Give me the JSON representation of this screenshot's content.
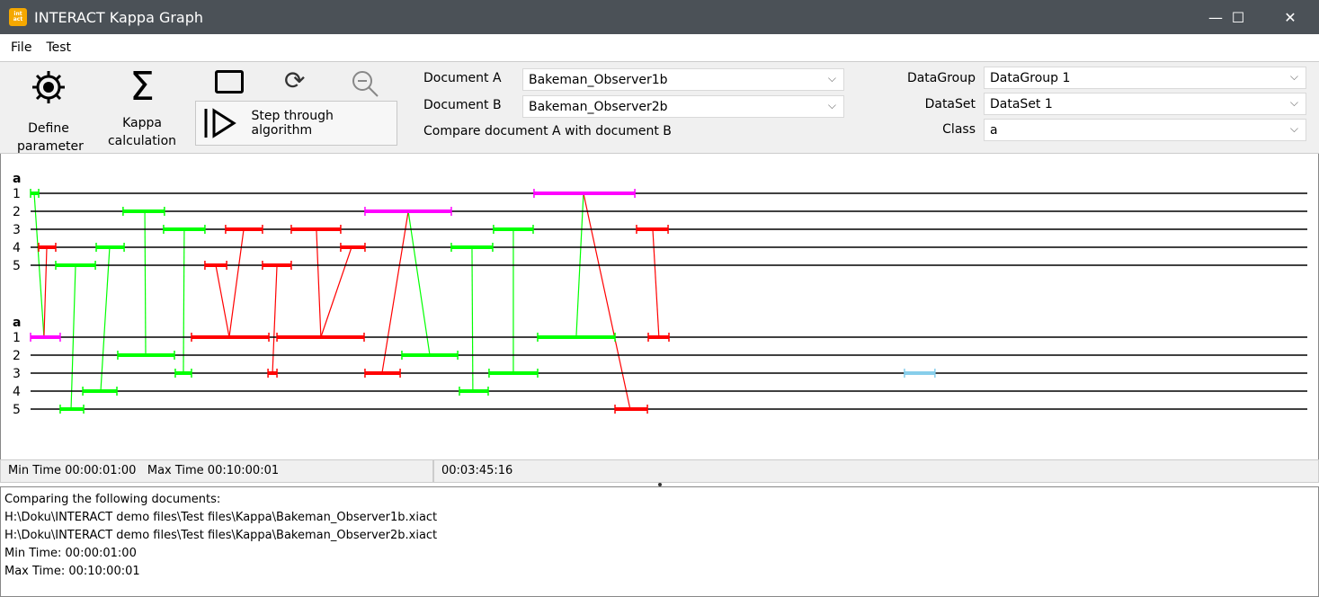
{
  "window": {
    "title": "INTERACT Kappa Graph",
    "logo_text": "interact",
    "minimize": "—",
    "maximize": "☐",
    "close": "✕"
  },
  "menu": [
    "File",
    "Test"
  ],
  "toolbar": {
    "define_parameter": "Define parameter",
    "kappa_calculation": "Kappa calculation",
    "step_through": "Step through algorithm",
    "document_a_label": "Document A",
    "document_a_value": "Bakeman_Observer1b",
    "document_b_label": "Document B",
    "document_b_value": "Bakeman_Observer2b",
    "compare_text": "Compare document A with document B",
    "datagroup_label": "DataGroup",
    "datagroup_value": "DataGroup 1",
    "dataset_label": "DataSet",
    "dataset_value": "DataSet 1",
    "class_label": "Class",
    "class_value": "a"
  },
  "graph": {
    "time_range_seconds": [
      1,
      600
    ],
    "colors": {
      "green": "#00ff00",
      "red": "#ff0000",
      "magenta": "#ff00ff",
      "lightblue": "#87ceeb"
    },
    "doc_a": {
      "class": "a",
      "rows": [
        "1",
        "2",
        "3",
        "4",
        "5"
      ],
      "segments": [
        {
          "row": 1,
          "start": 1.0,
          "end": 4.8,
          "color": "green"
        },
        {
          "row": 1,
          "start": 237.2,
          "end": 284.5,
          "color": "magenta"
        },
        {
          "row": 2,
          "start": 44.4,
          "end": 63.8,
          "color": "green"
        },
        {
          "row": 2,
          "start": 157.9,
          "end": 198.4,
          "color": "magenta"
        },
        {
          "row": 3,
          "start": 63.4,
          "end": 82.8,
          "color": "green"
        },
        {
          "row": 3,
          "start": 92.5,
          "end": 109.8,
          "color": "red"
        },
        {
          "row": 3,
          "start": 123.3,
          "end": 146.5,
          "color": "red"
        },
        {
          "row": 3,
          "start": 218.2,
          "end": 236.8,
          "color": "green"
        },
        {
          "row": 3,
          "start": 285.3,
          "end": 300.1,
          "color": "red"
        },
        {
          "row": 4,
          "start": 4.8,
          "end": 12.8,
          "color": "red"
        },
        {
          "row": 4,
          "start": 31.8,
          "end": 44.9,
          "color": "green"
        },
        {
          "row": 4,
          "start": 146.5,
          "end": 157.9,
          "color": "red"
        },
        {
          "row": 4,
          "start": 198.4,
          "end": 217.8,
          "color": "green"
        },
        {
          "row": 5,
          "start": 12.8,
          "end": 31.4,
          "color": "green"
        },
        {
          "row": 5,
          "start": 82.8,
          "end": 93.0,
          "color": "red"
        },
        {
          "row": 5,
          "start": 109.8,
          "end": 123.3,
          "color": "red"
        }
      ]
    },
    "doc_b": {
      "class": "a",
      "rows": [
        "1",
        "2",
        "3",
        "4",
        "5"
      ],
      "segments": [
        {
          "row": 1,
          "start": 1.0,
          "end": 14.9,
          "color": "magenta"
        },
        {
          "row": 1,
          "start": 76.5,
          "end": 112.8,
          "color": "red"
        },
        {
          "row": 1,
          "start": 116.6,
          "end": 157.5,
          "color": "red"
        },
        {
          "row": 1,
          "start": 238.9,
          "end": 275.2,
          "color": "green"
        },
        {
          "row": 1,
          "start": 290.8,
          "end": 300.5,
          "color": "red"
        },
        {
          "row": 2,
          "start": 41.9,
          "end": 68.5,
          "color": "green"
        },
        {
          "row": 2,
          "start": 175.2,
          "end": 201.4,
          "color": "green"
        },
        {
          "row": 3,
          "start": 68.9,
          "end": 76.5,
          "color": "green"
        },
        {
          "row": 3,
          "start": 112.4,
          "end": 116.6,
          "color": "red"
        },
        {
          "row": 3,
          "start": 157.9,
          "end": 174.4,
          "color": "red"
        },
        {
          "row": 3,
          "start": 216.1,
          "end": 238.9,
          "color": "green"
        },
        {
          "row": 3,
          "start": 411.0,
          "end": 425.3,
          "color": "lightblue"
        },
        {
          "row": 4,
          "start": 25.5,
          "end": 41.5,
          "color": "green"
        },
        {
          "row": 4,
          "start": 202.2,
          "end": 215.7,
          "color": "green"
        },
        {
          "row": 5,
          "start": 14.9,
          "end": 25.9,
          "color": "green"
        },
        {
          "row": 5,
          "start": 275.2,
          "end": 290.4,
          "color": "red"
        }
      ]
    },
    "links": [
      {
        "a_row": 1,
        "a_t": 2.7,
        "b_row": 1,
        "b_t": 7.3,
        "color": "green"
      },
      {
        "a_row": 4,
        "a_t": 8.6,
        "b_row": 1,
        "b_t": 7.3,
        "color": "red"
      },
      {
        "a_row": 5,
        "a_t": 22.1,
        "b_row": 5,
        "b_t": 20.0,
        "color": "green"
      },
      {
        "a_row": 4,
        "a_t": 38.1,
        "b_row": 4,
        "b_t": 33.9,
        "color": "green"
      },
      {
        "a_row": 2,
        "a_t": 54.6,
        "b_row": 2,
        "b_t": 55.0,
        "color": "green"
      },
      {
        "a_row": 3,
        "a_t": 73.1,
        "b_row": 3,
        "b_t": 72.7,
        "color": "green"
      },
      {
        "a_row": 5,
        "a_t": 87.9,
        "b_row": 1,
        "b_t": 94.2,
        "color": "red"
      },
      {
        "a_row": 3,
        "a_t": 101.0,
        "b_row": 1,
        "b_t": 94.2,
        "color": "red"
      },
      {
        "a_row": 5,
        "a_t": 116.6,
        "b_row": 3,
        "b_t": 114.5,
        "color": "red"
      },
      {
        "a_row": 3,
        "a_t": 135.1,
        "b_row": 1,
        "b_t": 137.2,
        "color": "red"
      },
      {
        "a_row": 4,
        "a_t": 151.6,
        "b_row": 1,
        "b_t": 137.2,
        "color": "red"
      },
      {
        "a_row": 2,
        "a_t": 178.2,
        "b_row": 3,
        "b_t": 165.9,
        "color": "red"
      },
      {
        "a_row": 2,
        "a_t": 178.2,
        "b_row": 2,
        "b_t": 188.3,
        "color": "green"
      },
      {
        "a_row": 4,
        "a_t": 208.1,
        "b_row": 4,
        "b_t": 208.5,
        "color": "green"
      },
      {
        "a_row": 3,
        "a_t": 227.5,
        "b_row": 3,
        "b_t": 227.5,
        "color": "green"
      },
      {
        "a_row": 1,
        "a_t": 260.4,
        "b_row": 1,
        "b_t": 257.0,
        "color": "green"
      },
      {
        "a_row": 1,
        "a_t": 260.4,
        "b_row": 5,
        "b_t": 282.3,
        "color": "red"
      },
      {
        "a_row": 3,
        "a_t": 292.9,
        "b_row": 1,
        "b_t": 295.8,
        "color": "red"
      }
    ]
  },
  "status": {
    "range": "Min Time 00:00:01:00   Max Time 00:10:00:01",
    "current": "00:03:45:16"
  },
  "log": [
    "Comparing the following documents:",
    "H:\\Doku\\INTERACT demo files\\Test files\\Kappa\\Bakeman_Observer1b.xiact",
    "H:\\Doku\\INTERACT demo files\\Test files\\Kappa\\Bakeman_Observer2b.xiact",
    "Min Time: 00:00:01:00",
    "Max Time: 00:10:00:01"
  ]
}
